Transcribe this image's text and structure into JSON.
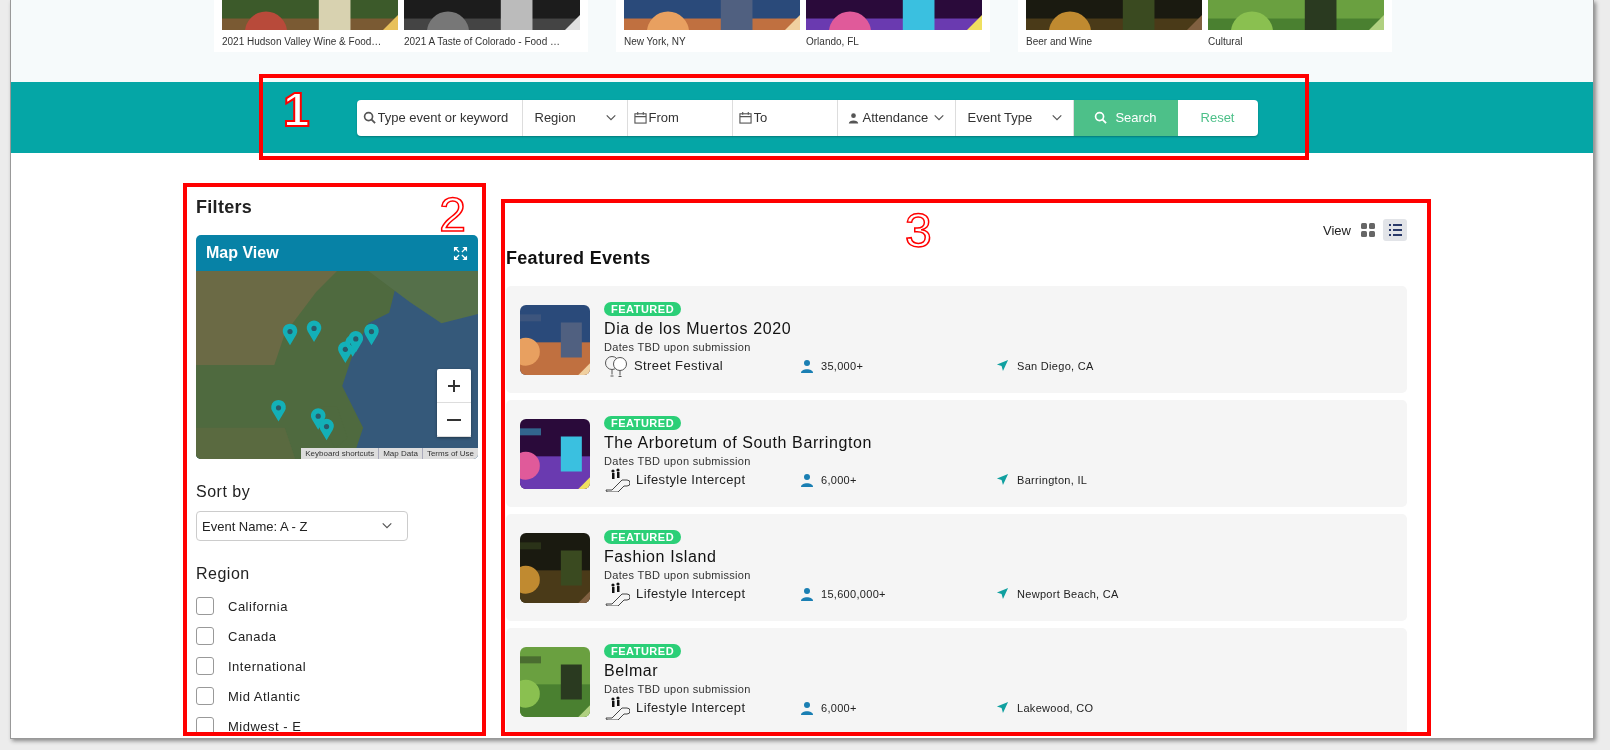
{
  "featured_strip": [
    {
      "tiles": [
        {
          "caption": "2021 Hudson Valley Wine & Food…"
        },
        {
          "caption": "2021 A Taste of Colorado - Food …"
        }
      ]
    },
    {
      "tiles": [
        {
          "caption": "New York, NY"
        },
        {
          "caption": "Orlando, FL"
        }
      ]
    },
    {
      "tiles": [
        {
          "caption": "Beer and Wine"
        },
        {
          "caption": "Cultural"
        }
      ]
    }
  ],
  "search_bar": {
    "keyword": {
      "placeholder": "Type event or keyword"
    },
    "region": "Region",
    "from": {
      "placeholder": "From"
    },
    "to": {
      "placeholder": "To"
    },
    "attendance": "Attendance",
    "event_type": "Event Type",
    "search_button": "Search",
    "reset_button": "Reset"
  },
  "filters": {
    "title": "Filters",
    "map": {
      "title": "Map View",
      "attribution": [
        "Keyboard shortcuts",
        "Map Data",
        "Terms of Use"
      ]
    },
    "sort": {
      "label": "Sort by",
      "value": "Event Name: A - Z"
    },
    "region": {
      "label": "Region",
      "options": [
        {
          "label": "California",
          "checked": false
        },
        {
          "label": "Canada",
          "checked": false
        },
        {
          "label": "International",
          "checked": false
        },
        {
          "label": "Mid Atlantic",
          "checked": false
        },
        {
          "label": "Midwest - E",
          "checked": false
        }
      ]
    }
  },
  "events": {
    "view_label": "View",
    "views": [
      {
        "kind": "grid",
        "selected": false
      },
      {
        "kind": "list",
        "selected": true
      }
    ],
    "title": "Featured Events",
    "items": [
      {
        "badge": "FEATURED",
        "name": "Dia de los Muertos 2020",
        "dates": "Dates TBD upon submission",
        "category": {
          "text": "Street Festival",
          "kind": "festival"
        },
        "attendance": "35,000+",
        "location": "San Diego, CA"
      },
      {
        "badge": "FEATURED",
        "name": "The Arboretum of South Barrington",
        "dates": "Dates TBD upon submission",
        "category": {
          "text": "Lifestyle Intercept",
          "kind": "lifestyle"
        },
        "attendance": "6,000+",
        "location": "Barrington, IL"
      },
      {
        "badge": "FEATURED",
        "name": "Fashion Island",
        "dates": "Dates TBD upon submission",
        "category": {
          "text": "Lifestyle Intercept",
          "kind": "lifestyle"
        },
        "attendance": "15,600,000+",
        "location": "Newport Beach, CA"
      },
      {
        "badge": "FEATURED",
        "name": "Belmar",
        "dates": "Dates TBD upon submission",
        "category": {
          "text": "Lifestyle Intercept",
          "kind": "lifestyle"
        },
        "attendance": "6,000+",
        "location": "Lakewood, CO"
      }
    ]
  },
  "annotations": [
    {
      "label": "1"
    },
    {
      "label": "2"
    },
    {
      "label": "3"
    }
  ]
}
